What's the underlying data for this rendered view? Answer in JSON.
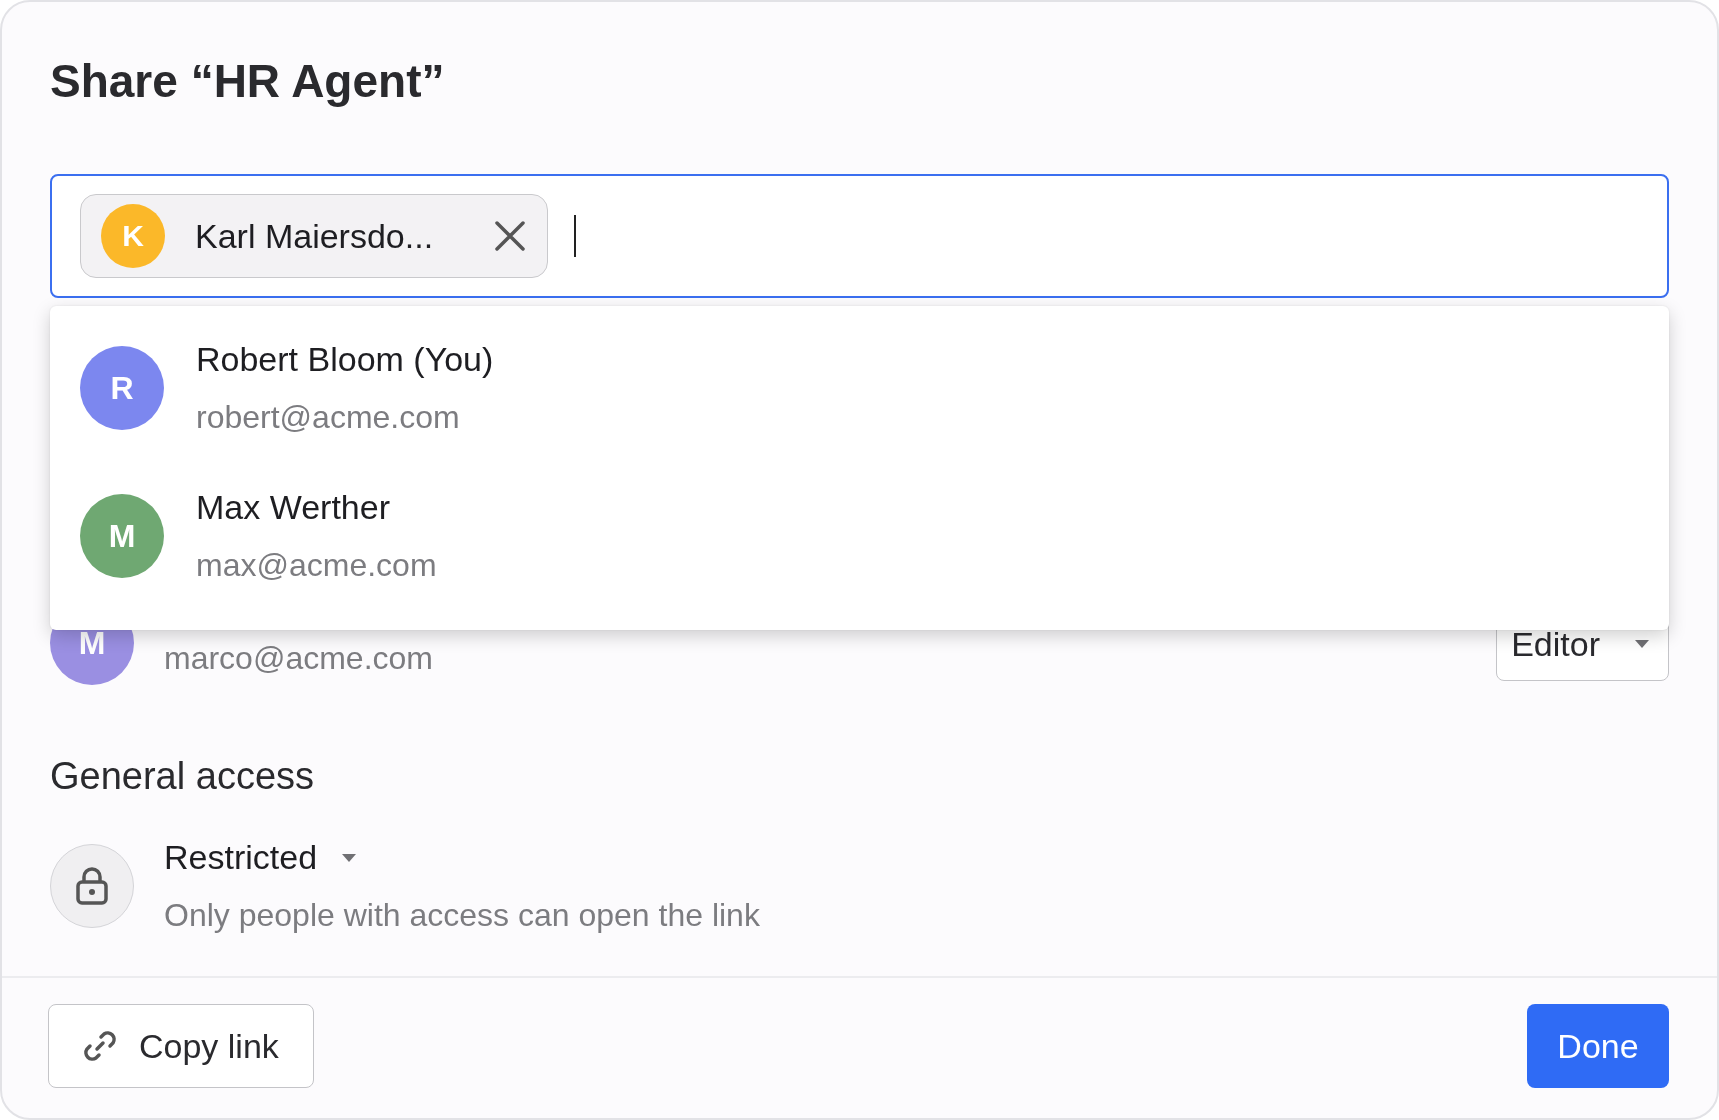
{
  "dialog": {
    "title": "Share “HR Agent”"
  },
  "recipient_field": {
    "chips": [
      {
        "initial": "K",
        "name": "Karl Maiersdo...",
        "color": "#fbb829"
      }
    ]
  },
  "suggestions": [
    {
      "initial": "R",
      "name": "Robert Bloom (You)",
      "email": "robert@acme.com",
      "color": "#7c87ef"
    },
    {
      "initial": "M",
      "name": "Max Werther",
      "email": "max@acme.com",
      "color": "#6fa872"
    }
  ],
  "people": [
    {
      "initial": "M",
      "email": "marco@acme.com",
      "role": "Editor",
      "color": "#9a8fe2"
    }
  ],
  "general_access": {
    "heading": "General access",
    "level": "Restricted",
    "description": "Only people with access can open the link"
  },
  "buttons": {
    "copy_link": "Copy link",
    "done": "Done"
  }
}
